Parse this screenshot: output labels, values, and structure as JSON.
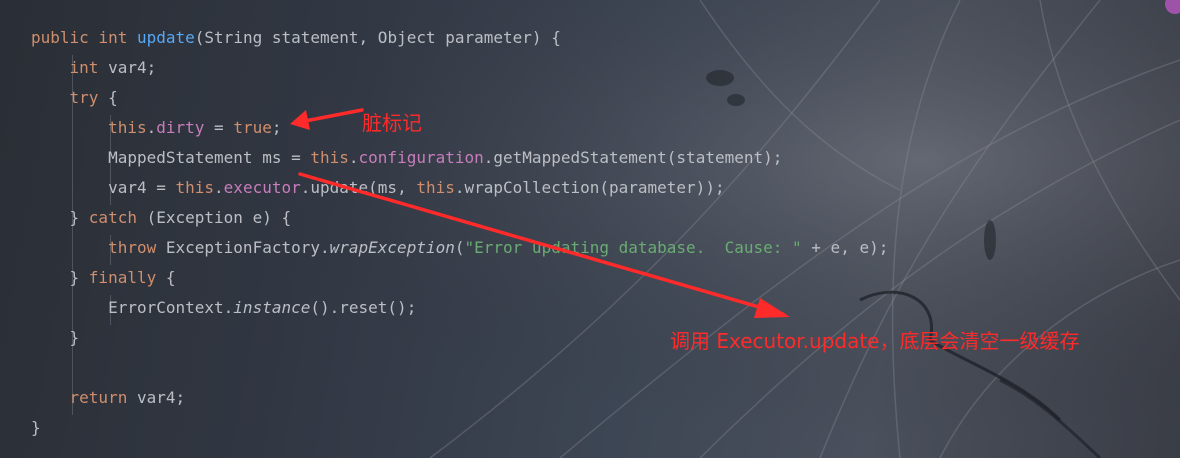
{
  "code": {
    "lines": [
      [
        {
          "t": "public",
          "c": "kw"
        },
        {
          "t": " "
        },
        {
          "t": "int",
          "c": "kw"
        },
        {
          "t": " "
        },
        {
          "t": "update",
          "c": "fn"
        },
        {
          "t": "(String statement, Object parameter) {"
        }
      ],
      [
        {
          "t": "    "
        },
        {
          "t": "int",
          "c": "kw"
        },
        {
          "t": " var4;"
        }
      ],
      [
        {
          "t": "    "
        },
        {
          "t": "try",
          "c": "kw"
        },
        {
          "t": " {"
        }
      ],
      [
        {
          "t": "        "
        },
        {
          "t": "this",
          "c": "kw"
        },
        {
          "t": "."
        },
        {
          "t": "dirty",
          "c": "fld"
        },
        {
          "t": " = "
        },
        {
          "t": "true",
          "c": "kw"
        },
        {
          "t": ";"
        }
      ],
      [
        {
          "t": "        MappedStatement ms = "
        },
        {
          "t": "this",
          "c": "kw"
        },
        {
          "t": "."
        },
        {
          "t": "configuration",
          "c": "fld"
        },
        {
          "t": ".getMappedStatement(statement);"
        }
      ],
      [
        {
          "t": "        var4 = "
        },
        {
          "t": "this",
          "c": "kw"
        },
        {
          "t": "."
        },
        {
          "t": "executor",
          "c": "fld"
        },
        {
          "t": ".update(ms, "
        },
        {
          "t": "this",
          "c": "kw"
        },
        {
          "t": ".wrapCollection(parameter));"
        }
      ],
      [
        {
          "t": "    } "
        },
        {
          "t": "catch",
          "c": "kw"
        },
        {
          "t": " (Exception e) {"
        }
      ],
      [
        {
          "t": "        "
        },
        {
          "t": "throw",
          "c": "kw"
        },
        {
          "t": " ExceptionFactory."
        },
        {
          "t": "wrapException",
          "c": "it"
        },
        {
          "t": "("
        },
        {
          "t": "\"Error updating database.  Cause: \"",
          "c": "str"
        },
        {
          "t": " + e, e);"
        }
      ],
      [
        {
          "t": "    } "
        },
        {
          "t": "finally",
          "c": "kw"
        },
        {
          "t": " {"
        }
      ],
      [
        {
          "t": "        ErrorContext."
        },
        {
          "t": "instance",
          "c": "it"
        },
        {
          "t": "().reset();"
        }
      ],
      [
        {
          "t": "    }"
        }
      ],
      [
        {
          "t": ""
        }
      ],
      [
        {
          "t": "    "
        },
        {
          "t": "return",
          "c": "kw"
        },
        {
          "t": " var4;"
        }
      ],
      [
        {
          "t": "}"
        }
      ]
    ]
  },
  "annotations": {
    "dirty_note": "脏标记",
    "update_note": "调用 Executor.update，底层会清空一级缓存"
  },
  "colors": {
    "annotation": "#ff2a2a",
    "keyword": "#cf8e6d",
    "method": "#56a8f5",
    "field": "#c77dbb",
    "string": "#6aab73",
    "text": "#bcbec4"
  }
}
